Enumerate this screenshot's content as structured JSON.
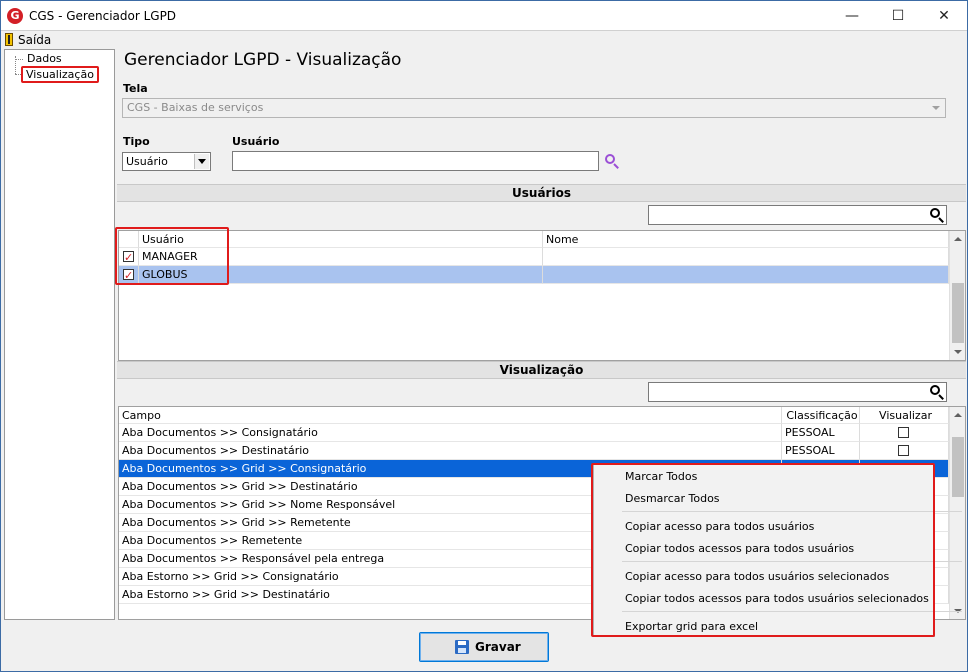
{
  "window": {
    "title": "CGS - Gerenciador LGPD",
    "minimize": "—",
    "maximize": "☐",
    "close": "✕"
  },
  "menu": {
    "exit_label": "Saída"
  },
  "tree": {
    "items": [
      "Dados",
      "Visualização"
    ]
  },
  "page": {
    "heading": "Gerenciador LGPD - Visualização"
  },
  "form": {
    "tela_label": "Tela",
    "tela_value": "CGS - Baixas de serviços",
    "tipo_label": "Tipo",
    "tipo_value": "Usuário",
    "usuario_label": "Usuário",
    "usuario_value": ""
  },
  "users_section": {
    "title": "Usuários",
    "search_value": "",
    "columns": [
      "Usuário",
      "Nome"
    ],
    "rows": [
      {
        "checked": true,
        "usuario": "MANAGER",
        "nome": ""
      },
      {
        "checked": true,
        "usuario": "GLOBUS",
        "nome": ""
      }
    ]
  },
  "view_section": {
    "title": "Visualização",
    "search_value": "",
    "columns": [
      "Campo",
      "Classificação",
      "Visualizar"
    ],
    "rows": [
      {
        "campo": "Aba Documentos >> Consignatário",
        "classificacao": "PESSOAL",
        "visualizar": false
      },
      {
        "campo": "Aba Documentos >> Destinatário",
        "classificacao": "PESSOAL",
        "visualizar": false
      },
      {
        "campo": "Aba Documentos >> Grid >> Consignatário",
        "classificacao": "",
        "visualizar": false
      },
      {
        "campo": "Aba Documentos >> Grid >> Destinatário",
        "classificacao": "",
        "visualizar": false
      },
      {
        "campo": "Aba Documentos >> Grid >> Nome Responsável",
        "classificacao": "",
        "visualizar": false
      },
      {
        "campo": "Aba Documentos >> Grid >> Remetente",
        "classificacao": "",
        "visualizar": false
      },
      {
        "campo": "Aba Documentos >> Remetente",
        "classificacao": "",
        "visualizar": false
      },
      {
        "campo": "Aba Documentos >> Responsável pela entrega",
        "classificacao": "",
        "visualizar": false
      },
      {
        "campo": "Aba Estorno >> Grid >> Consignatário",
        "classificacao": "",
        "visualizar": false
      },
      {
        "campo": "Aba Estorno >> Grid >> Destinatário",
        "classificacao": "",
        "visualizar": false
      }
    ]
  },
  "context_menu": {
    "items": [
      "Marcar Todos",
      "Desmarcar Todos",
      "Copiar acesso para todos usuários",
      "Copiar todos acessos para todos usuários",
      "Copiar acesso para todos usuários selecionados",
      "Copiar todos acessos para todos usuários selecionados",
      "Exportar grid para excel"
    ]
  },
  "footer": {
    "save_label": "Gravar"
  },
  "colors": {
    "highlight_red": "#e01b1b",
    "row_selected_light": "#a9c3ef",
    "row_selected_dark": "#0a64d8",
    "search_icon_purple": "#9b4fd6",
    "brand_red": "#d31f26"
  }
}
